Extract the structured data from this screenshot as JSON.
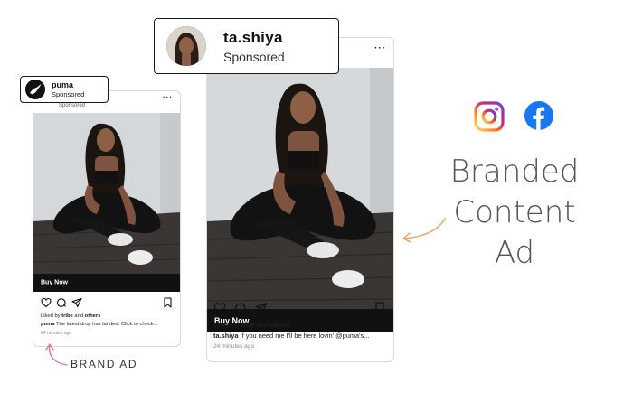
{
  "brand_ad_card": {
    "sponsored_label": "Sponsored",
    "menu": "···",
    "cta": "Buy Now",
    "liked_prefix": "Liked by ",
    "liked_user": "tribe",
    "liked_mid": " and ",
    "liked_others": "others",
    "caption_user": "puma",
    "caption_text": " The latest drop has landed. Click to check...",
    "time": "24 minutes ago"
  },
  "branded_content_card": {
    "menu": "···",
    "cta": "Buy Now",
    "liked_prefix": "Liked by ",
    "liked_user": "tribe",
    "liked_mid": " and ",
    "liked_others": "others",
    "caption_user": "ta.shiya",
    "caption_text": " If you need me I'll be here lovin' @puma's...",
    "time": "24 minutes ago"
  },
  "puma_tag": {
    "name": "puma",
    "sub": "Sponsored"
  },
  "tashiya_tag": {
    "name": "ta.shiya",
    "sub": "Sponsored"
  },
  "headline": {
    "line1": "Branded",
    "line2": "Content",
    "line3": "Ad"
  },
  "brand_ad_label": "BRAND AD",
  "colors": {
    "arrow_orange": "#f0a35a",
    "arrow_pink": "#e76aa8",
    "facebook_blue": "#1877f2",
    "cta_black": "#111111"
  },
  "icons": [
    "instagram-icon",
    "facebook-icon",
    "heart-icon",
    "comment-icon",
    "share-icon",
    "bookmark-icon",
    "more-icon"
  ]
}
